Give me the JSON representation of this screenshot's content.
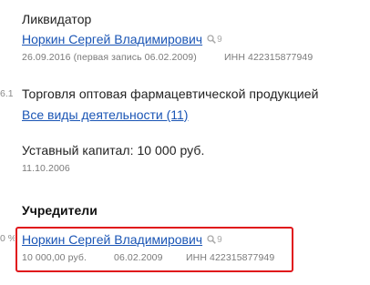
{
  "liquidator": {
    "role_label": "Ликвидатор",
    "person_name": "Норкин Сергей Владимирович",
    "search_count": "9",
    "date_text": "26.09.2016 (первая запись 06.02.2009)",
    "inn_text": "ИНН 422315877949"
  },
  "activity": {
    "left_cut_text": "6.1",
    "main_activity": "Торговля оптовая фармацевтической продукцией",
    "all_activities_link": "Все виды деятельности (11)"
  },
  "capital": {
    "label": "Уставный капитал: 10 000 руб.",
    "date": "11.10.2006"
  },
  "founders": {
    "title": "Учредители",
    "left_cut_text": "0 %",
    "items": [
      {
        "name": "Норкин Сергей Владимирович",
        "search_count": "9",
        "amount": "10 000,00 руб.",
        "date": "06.02.2009",
        "inn": "ИНН 422315877949"
      }
    ]
  },
  "colors": {
    "link": "#1a55b5",
    "highlight_border": "#e0151b",
    "meta_text": "#7a7a7a"
  },
  "icons": {
    "search_hint": "magnifier-icon"
  }
}
